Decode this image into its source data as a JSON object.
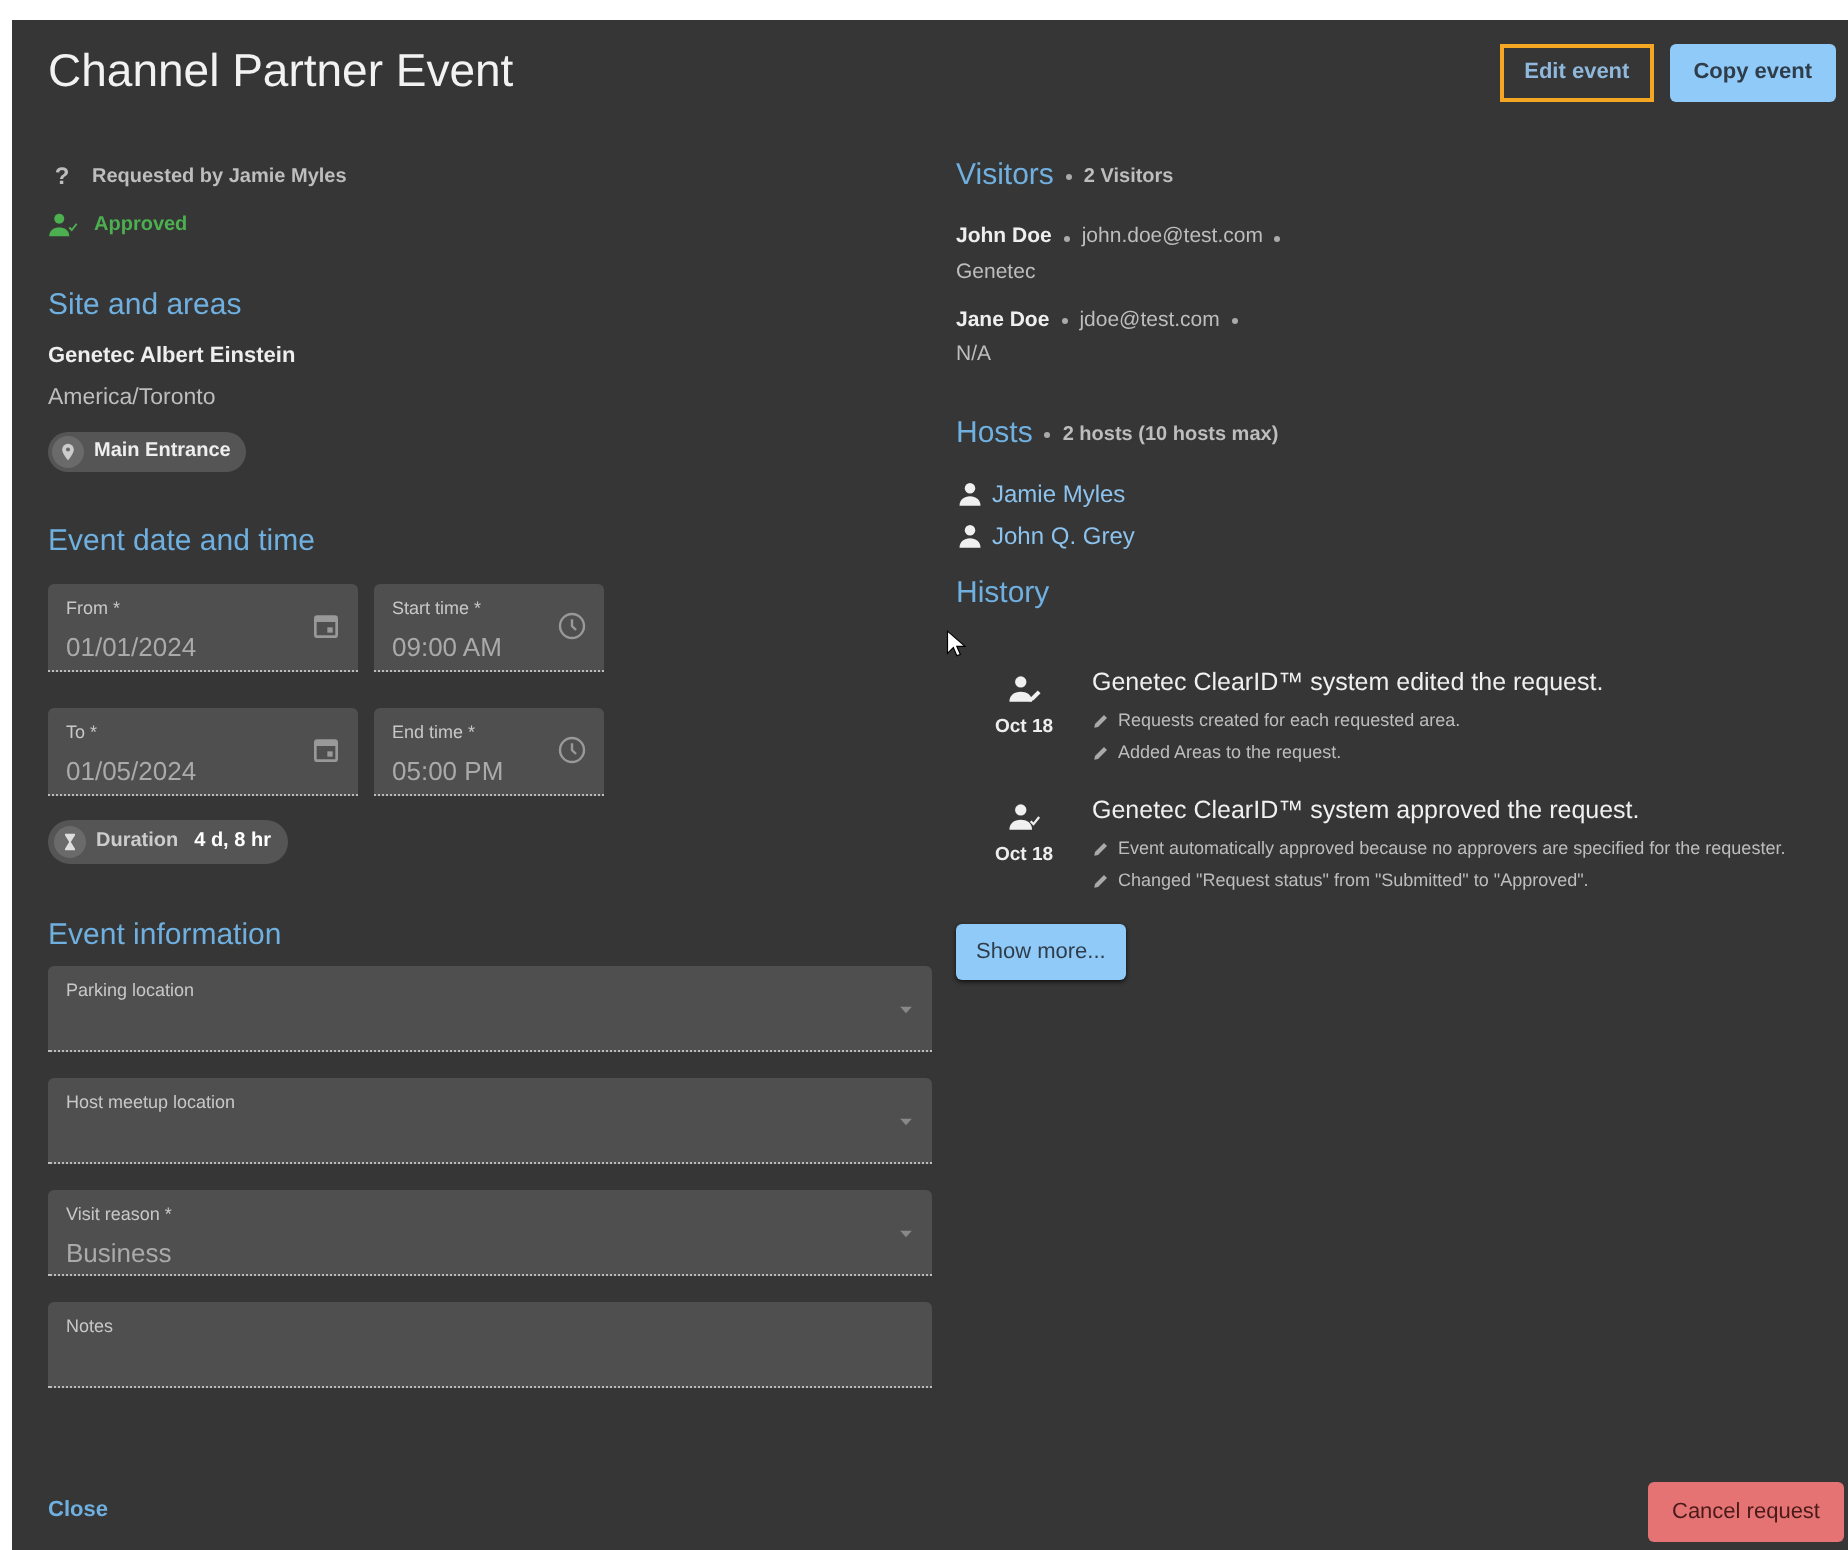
{
  "title": "Channel Partner Event",
  "header_buttons": [
    {
      "label": "Edit event",
      "kind": "text",
      "focused": true
    },
    {
      "label": "Copy event",
      "kind": "filled",
      "focused": false
    }
  ],
  "request": {
    "icon": "?",
    "requested_by": "Requested by Jamie Myles",
    "status": "Approved"
  },
  "site": {
    "heading": "Site and areas",
    "name": "Genetec Albert Einstein",
    "timezone": "America/Toronto",
    "areas": [
      "Main Entrance"
    ]
  },
  "datetime": {
    "heading": "Event date and time",
    "fields": [
      {
        "label": "From *",
        "value": "01/01/2024",
        "kind": "date"
      },
      {
        "label": "Start time *",
        "value": "09:00 AM",
        "kind": "time"
      },
      {
        "label": "To *",
        "value": "01/05/2024",
        "kind": "date"
      },
      {
        "label": "End time *",
        "value": "05:00 PM",
        "kind": "time"
      }
    ],
    "duration": {
      "label": "Duration",
      "value": "4 d, 8 hr"
    }
  },
  "event_info": {
    "heading": "Event information",
    "fields": [
      {
        "label": "Parking location",
        "kind": "select"
      },
      {
        "label": "Host meetup location",
        "kind": "select"
      },
      {
        "label": "Visit reason *",
        "value": "Business",
        "kind": "select"
      },
      {
        "label": "Notes",
        "kind": "text"
      }
    ]
  },
  "visitors": {
    "heading": "Visitors",
    "count": "2 Visitors",
    "items": [
      {
        "name": "John Doe",
        "email": "john.doe@test.com",
        "company": "Genetec"
      },
      {
        "name": "Jane Doe",
        "email": "jdoe@test.com",
        "company": "N/A"
      }
    ]
  },
  "hosts": {
    "heading": "Hosts",
    "count": "2 hosts (10 hosts max)",
    "items": [
      "Jamie Myles",
      "John Q. Grey"
    ]
  },
  "history": {
    "heading": "History",
    "items": [
      {
        "kind": "edited",
        "date": "Oct 18",
        "title": "Genetec ClearID™ system edited the request.",
        "notes": [
          "Requests created for each requested area.",
          "Added Areas to the request."
        ]
      },
      {
        "kind": "approved",
        "date": "Oct 18",
        "title": "Genetec ClearID™ system approved the request.",
        "notes": [
          "Event automatically approved because no approvers are specified for the requester.",
          "Changed \"Request status\" from \"Submitted\" to \"Approved\"."
        ]
      }
    ],
    "show_more": "Show more..."
  },
  "footer": {
    "close": "Close",
    "cancel": "Cancel request"
  }
}
